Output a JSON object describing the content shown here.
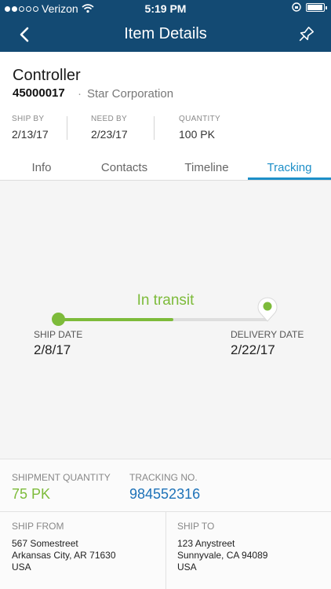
{
  "status_bar": {
    "carrier": "Verizon",
    "time": "5:19 PM"
  },
  "nav": {
    "title": "Item Details"
  },
  "item": {
    "name": "Controller",
    "id": "45000017",
    "company": "Star Corporation"
  },
  "meta": [
    {
      "label": "SHIP BY",
      "value": "2/13/17"
    },
    {
      "label": "NEED BY",
      "value": "2/23/17"
    },
    {
      "label": "QUANTITY",
      "value": "100 PK"
    }
  ],
  "tabs": [
    {
      "label": "Info"
    },
    {
      "label": "Contacts"
    },
    {
      "label": "Timeline"
    },
    {
      "label": "Tracking",
      "active": true
    }
  ],
  "tracking": {
    "status": "In transit",
    "progress": 0.55,
    "ship_label": "SHIP DATE",
    "ship_date": "2/8/17",
    "delivery_label": "DELIVERY DATE",
    "delivery_date": "2/22/17"
  },
  "shipment": {
    "quantity_label": "SHIPMENT QUANTITY",
    "quantity": "75 PK",
    "tracking_label": "TRACKING NO.",
    "tracking_no": "984552316",
    "from_label": "SHIP FROM",
    "from": {
      "line1": "567 Somestreet",
      "line2": "Arkansas City, AR 71630",
      "line3": "USA"
    },
    "to_label": "SHIP TO",
    "to": {
      "line1": "123 Anystreet",
      "line2": "Sunnyvale, CA 94089",
      "line3": "USA"
    }
  },
  "colors": {
    "nav_bg": "#134a73",
    "accent": "#1d8fc8",
    "green": "#7dbb3a"
  }
}
